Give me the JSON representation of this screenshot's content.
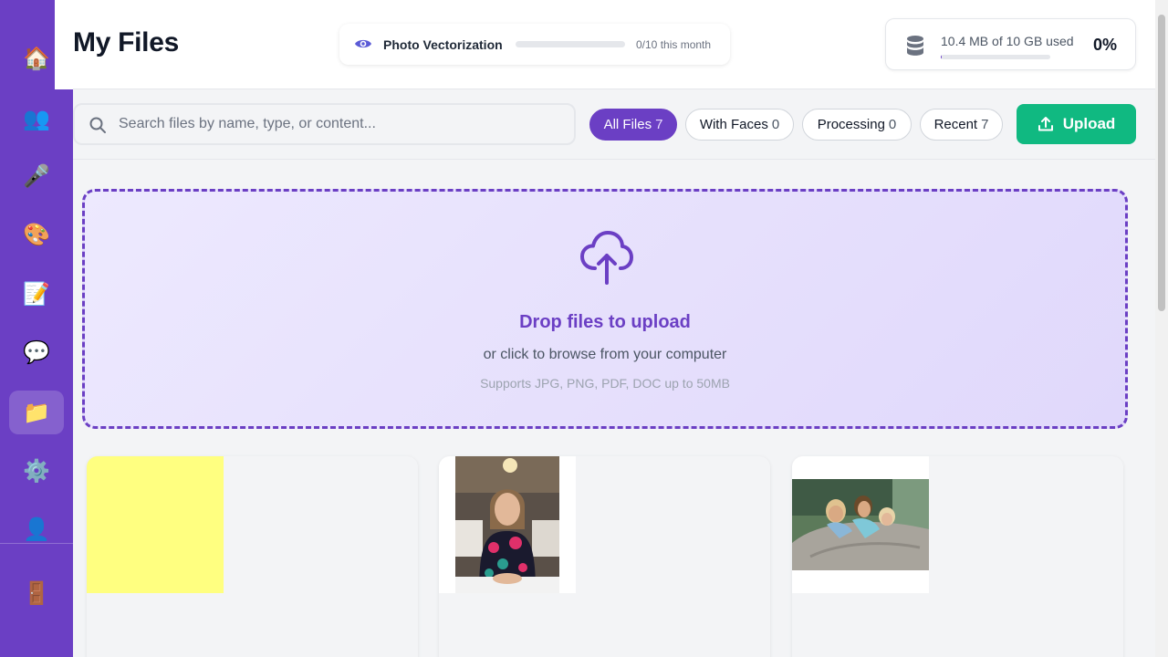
{
  "sidebar": {
    "items": [
      {
        "name": "home",
        "icon": "🏠"
      },
      {
        "name": "people",
        "icon": "👥"
      },
      {
        "name": "microphone",
        "icon": "🎤"
      },
      {
        "name": "palette",
        "icon": "🎨"
      },
      {
        "name": "notes",
        "icon": "📝"
      },
      {
        "name": "chat",
        "icon": "💬"
      },
      {
        "name": "files",
        "icon": "📁",
        "active": true
      },
      {
        "name": "settings",
        "icon": "⚙️"
      },
      {
        "name": "profile",
        "icon": "👤"
      },
      {
        "name": "logout",
        "icon": "🚪"
      }
    ]
  },
  "header": {
    "title": "My Files",
    "vectorization": {
      "label": "Photo Vectorization",
      "count_text": "0/10 this month",
      "progress": 0
    },
    "storage": {
      "text": "10.4 MB of 10 GB used",
      "percent_text": "0%",
      "progress": 0.001
    }
  },
  "toolbar": {
    "search_placeholder": "Search files by name, type, or content...",
    "filters": [
      {
        "label": "All Files",
        "count": "7",
        "active": true
      },
      {
        "label": "With Faces",
        "count": "0"
      },
      {
        "label": "Processing",
        "count": "0"
      },
      {
        "label": "Recent",
        "count": "7"
      }
    ],
    "upload_label": "Upload"
  },
  "dropzone": {
    "title": "Drop files to upload",
    "subtitle": "or click to browse from your computer",
    "hint": "Supports JPG, PNG, PDF, DOC up to 50MB"
  },
  "files": [
    {
      "kind": "yellow-image"
    },
    {
      "kind": "portrait-photo"
    },
    {
      "kind": "group-photo"
    }
  ],
  "colors": {
    "brand": "#6b3fc4",
    "upload": "#10b981"
  }
}
